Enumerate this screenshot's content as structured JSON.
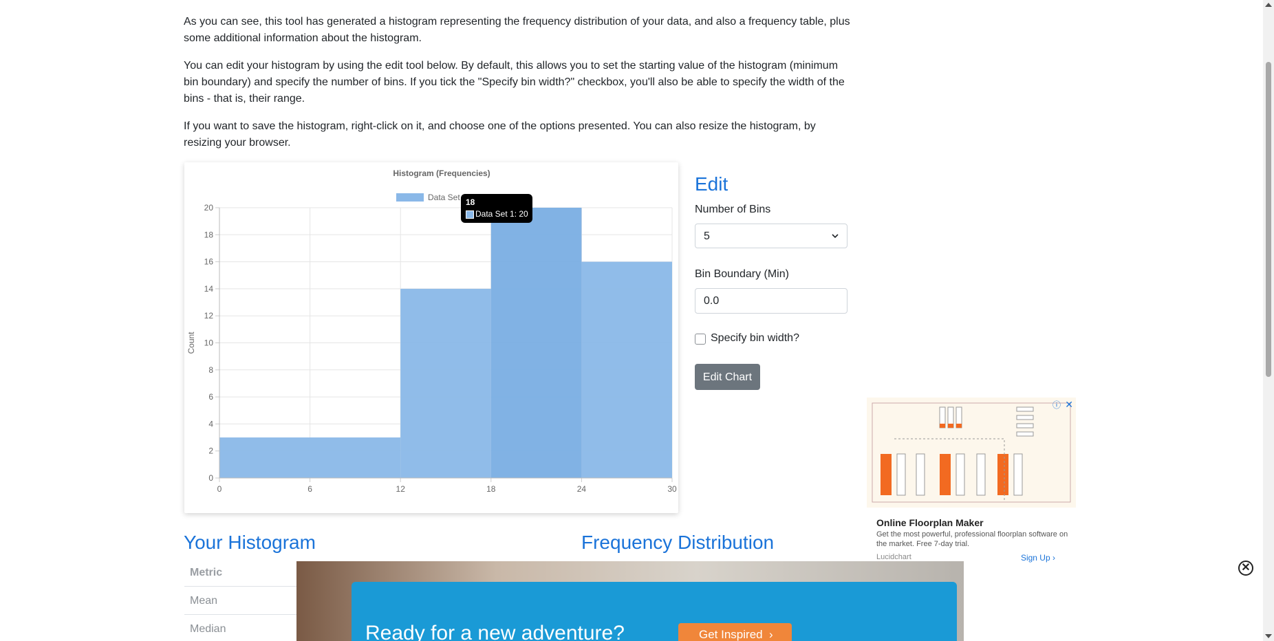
{
  "intro": {
    "p1": "As you can see, this tool has generated a histogram representing the frequency distribution of your data, and also a frequency table, plus some additional information about the histogram.",
    "p2": "You can edit your histogram by using the edit tool below. By default, this allows you to set the starting value of the histogram (minimum bin boundary) and specify the number of bins. If you tick the \"Specify bin width?\" checkbox, you'll also be able to specify the width of the bins - that is, their range.",
    "p3": "If you want to save the histogram, right-click on it, and choose one of the options presented. You can also resize the histogram, by resizing your browser."
  },
  "chart_data": {
    "type": "bar",
    "title": "Histogram (Frequencies)",
    "ylabel": "Count",
    "xlabel": "",
    "x_ticks": [
      0,
      6,
      12,
      18,
      24,
      30
    ],
    "y_ticks": [
      0,
      2,
      4,
      6,
      8,
      10,
      12,
      14,
      16,
      18,
      20
    ],
    "ylim": [
      0,
      20
    ],
    "xlim": [
      0,
      30
    ],
    "bins": [
      {
        "start": 0,
        "end": 12,
        "value": 3
      },
      {
        "start": 12,
        "end": 18,
        "value": 14
      },
      {
        "start": 18,
        "end": 24,
        "value": 20
      },
      {
        "start": 24,
        "end": 30,
        "value": 16
      }
    ],
    "series": [
      {
        "name": "Data Set 1",
        "color": "#8ab8e8"
      }
    ],
    "legend_label": "Data Set",
    "grid": true
  },
  "tooltip": {
    "title": "18",
    "body": "Data Set 1: 20"
  },
  "edit": {
    "heading": "Edit",
    "bins_label": "Number of Bins",
    "bins_value": "5",
    "boundary_label": "Bin Boundary (Min)",
    "boundary_value": "0.0",
    "checkbox_label": "Specify bin width?",
    "button_label": "Edit Chart"
  },
  "sections": {
    "your_histogram": "Your Histogram",
    "frequency_distribution": "Frequency Distribution",
    "metric_header": "Metric",
    "metric_rows": [
      "Mean",
      "Median"
    ]
  },
  "ad_right": {
    "title": "Online Floorplan Maker",
    "description": "Get the most powerful, professional floorplan software on the market. Free 7-day trial.",
    "brand": "Lucidchart",
    "cta": "Sign Up",
    "close": "✕",
    "info": "ⓘ"
  },
  "ad_bottom": {
    "headline": "Ready for a new adventure?",
    "cta": "Get Inspired",
    "close": "✕"
  },
  "colors": {
    "accent": "#1a73d9",
    "bar": "#8ab8e8",
    "bar_hover": "#7aaee3",
    "button": "#6c757d"
  }
}
